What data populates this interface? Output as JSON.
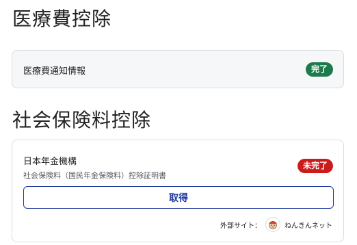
{
  "sections": {
    "medical": {
      "title": "医療費控除",
      "item": {
        "label": "医療費通知情報",
        "status": "完了"
      }
    },
    "social": {
      "title": "社会保険料控除",
      "item": {
        "org": "日本年金機構",
        "doc": "社会保険料（国民年金保険料）控除証明書",
        "status": "未完了",
        "action_label": "取得",
        "external_prefix": "外部サイト：",
        "external_site": "ねんきんネット",
        "external_icon": "nenkin-mascot-icon"
      }
    }
  },
  "colors": {
    "done": "#1d7a4a",
    "todo": "#cc1b1b",
    "accent": "#1d3a9f"
  }
}
